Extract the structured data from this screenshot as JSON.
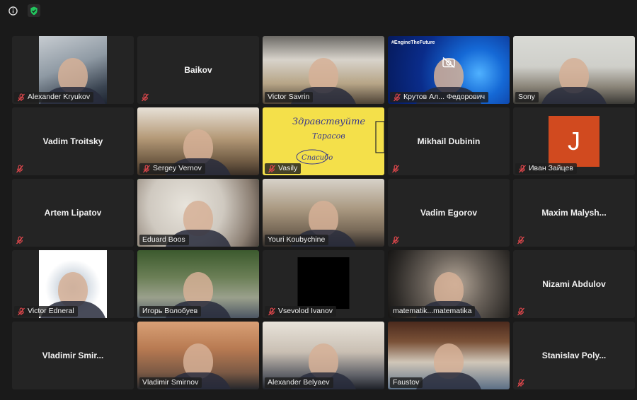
{
  "topbar": {
    "info_icon": "info-icon",
    "shield_icon": "shield-icon",
    "shield_color": "#22c55e"
  },
  "accent": {
    "active_speaker_border": "#23d96e",
    "muted_mic": "#e5484d"
  },
  "participants": [
    {
      "name": "Alexander Kryukov",
      "type": "photo",
      "muted": true
    },
    {
      "name": "Baikov",
      "type": "name",
      "muted": true
    },
    {
      "name": "Victor Savrin",
      "type": "video",
      "muted": false
    },
    {
      "name": "Крутов Ал... Федорович",
      "type": "video",
      "muted": true
    },
    {
      "name": "Sony",
      "type": "video",
      "muted": false
    },
    {
      "name": "Vadim Troitsky",
      "type": "name",
      "muted": true
    },
    {
      "name": "Sergey Vernov",
      "type": "video",
      "muted": true
    },
    {
      "name": "Vasily",
      "type": "video",
      "muted": true
    },
    {
      "name": "Mikhail Dubinin",
      "type": "name",
      "muted": true
    },
    {
      "name": "Иван Зайцев",
      "type": "avatar",
      "avatar_letter": "J",
      "muted": true
    },
    {
      "name": "Artem Lipatov",
      "type": "name",
      "muted": true
    },
    {
      "name": "Eduard Boos",
      "type": "video",
      "muted": false,
      "active": true
    },
    {
      "name": "Youri Koubychine",
      "type": "video",
      "muted": false
    },
    {
      "name": "Vadim Egorov",
      "type": "name",
      "muted": true
    },
    {
      "name": "Maxim Malysh...",
      "type": "name",
      "muted": true
    },
    {
      "name": "Victor Edneral",
      "type": "photo",
      "muted": true
    },
    {
      "name": "Игорь Волобуев",
      "type": "video",
      "muted": false
    },
    {
      "name": "Vsevolod Ivanov",
      "type": "black",
      "muted": true
    },
    {
      "name": "matematik...matematika",
      "type": "video",
      "muted": false
    },
    {
      "name": "Nizami Abdulov",
      "type": "name",
      "muted": true
    },
    {
      "name": "Vladimir Smir...",
      "type": "name",
      "muted": false
    },
    {
      "name": "Vladimir Smirnov",
      "type": "video",
      "muted": false
    },
    {
      "name": "Alexander Belyaev",
      "type": "video",
      "muted": false
    },
    {
      "name": "Faustov",
      "type": "video",
      "muted": false
    },
    {
      "name": "Stanislav Poly...",
      "type": "name",
      "muted": true
    }
  ],
  "slides": {
    "engine_text": "#EngineTheFuture",
    "vasily_note_line1": "Здравствуйте",
    "vasily_note_line2": "Тарасов",
    "vasily_note_line3": "Спасибо"
  }
}
